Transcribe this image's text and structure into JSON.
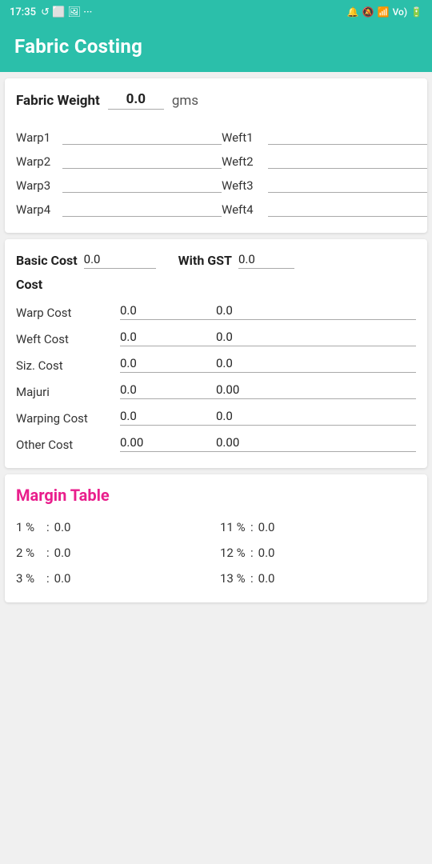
{
  "statusBar": {
    "time": "17:35",
    "rightIcons": "🔔🔕 📶 🔋"
  },
  "appBar": {
    "title": "Fabric Costing"
  },
  "fabricWeight": {
    "label": "Fabric Weight",
    "value": "0.0",
    "unit": "gms"
  },
  "warpFields": [
    {
      "label": "Warp1",
      "value": ""
    },
    {
      "label": "Warp2",
      "value": ""
    },
    {
      "label": "Warp3",
      "value": ""
    },
    {
      "label": "Warp4",
      "value": ""
    }
  ],
  "weftFields": [
    {
      "label": "Weft1",
      "value": ""
    },
    {
      "label": "Weft2",
      "value": ""
    },
    {
      "label": "Weft3",
      "value": ""
    },
    {
      "label": "Weft4",
      "value": ""
    }
  ],
  "basicCost": {
    "label": "Basic Cost",
    "value": "0.0",
    "gstLabel": "With GST",
    "gstValue": "0.0"
  },
  "costSection": {
    "heading": "Cost",
    "rows": [
      {
        "label": "Warp Cost",
        "val1": "0.0",
        "val2": "0.0"
      },
      {
        "label": "Weft Cost",
        "val1": "0.0",
        "val2": "0.0"
      },
      {
        "label": "Siz. Cost",
        "val1": "0.0",
        "val2": "0.0"
      },
      {
        "label": "Majuri",
        "val1": "0.0",
        "val2": "0.00"
      },
      {
        "label": "Warping Cost",
        "val1": "0.0",
        "val2": "0.0"
      },
      {
        "label": "Other Cost",
        "val1": "0.00",
        "val2": "0.00"
      }
    ]
  },
  "marginTable": {
    "title": "Margin Table",
    "leftItems": [
      {
        "pct": "1 %",
        "val": "0.0"
      },
      {
        "pct": "2 %",
        "val": "0.0"
      },
      {
        "pct": "3 %",
        "val": "0.0"
      }
    ],
    "rightItems": [
      {
        "pct": "11 %",
        "val": "0.0"
      },
      {
        "pct": "12 %",
        "val": "0.0"
      },
      {
        "pct": "13 %",
        "val": "0.0"
      }
    ]
  }
}
